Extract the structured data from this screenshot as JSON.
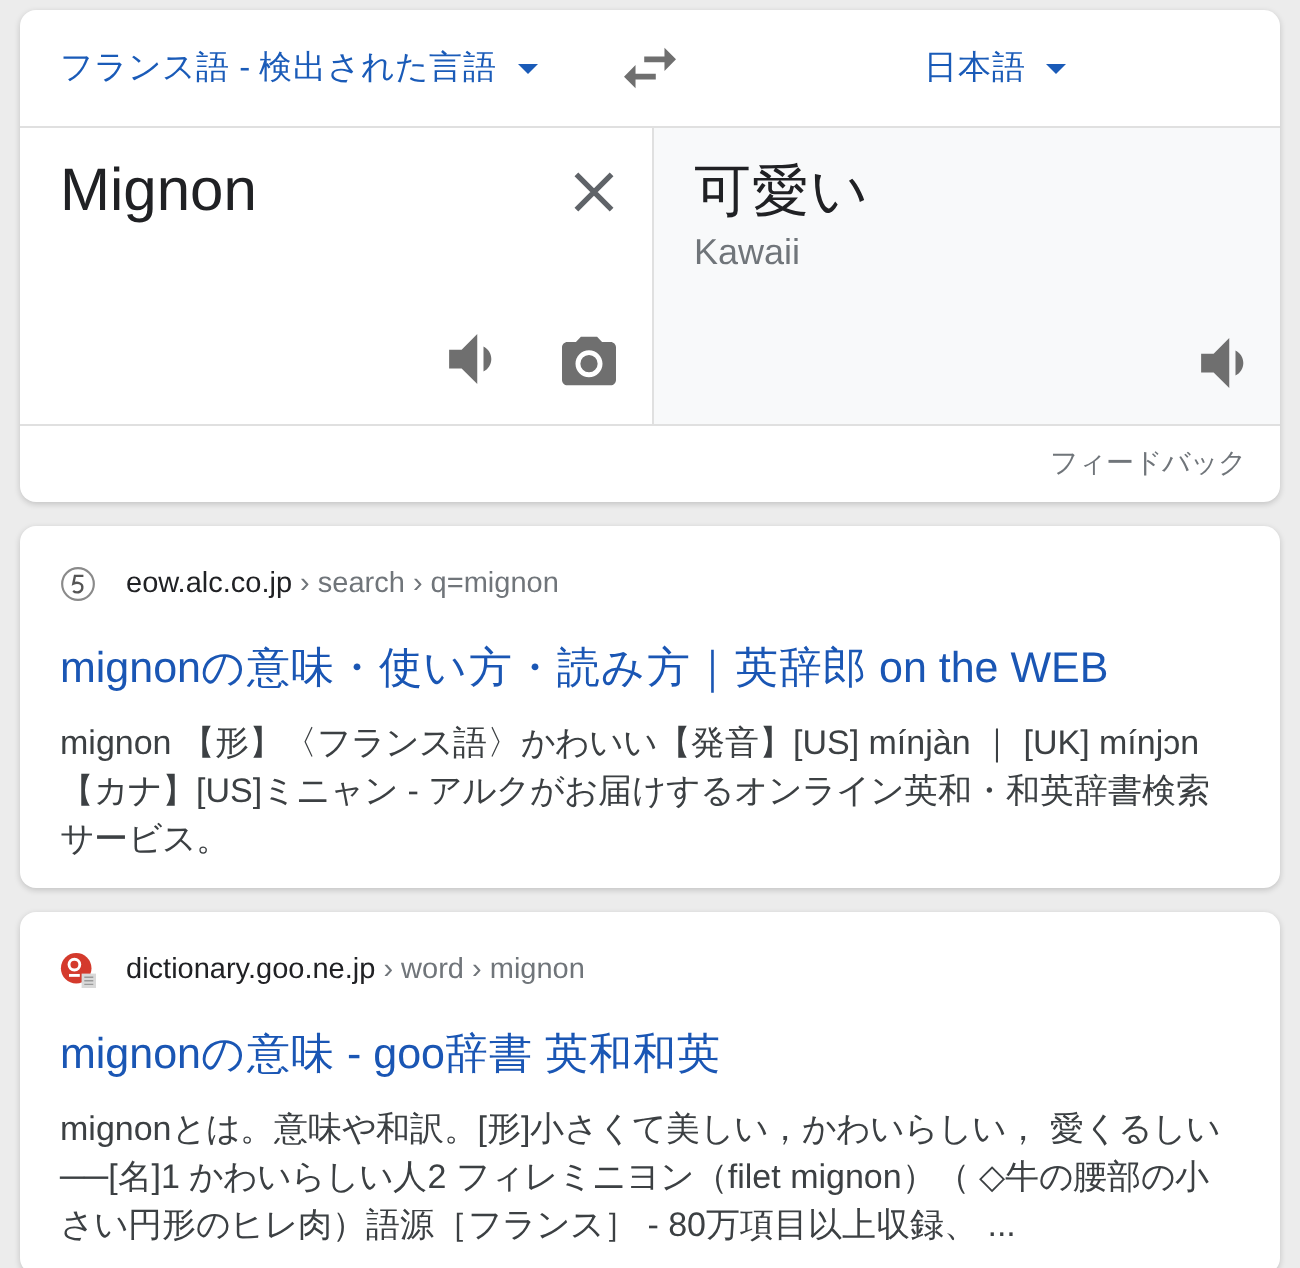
{
  "translator": {
    "source_language": "フランス語 - 検出された言語",
    "target_language": "日本語",
    "source_text": "Mignon",
    "translation": "可愛い",
    "transliteration": "Kawaii",
    "feedback": "フィードバック"
  },
  "results": [
    {
      "kind": "swirl",
      "site": "eow.alc.co.jp",
      "breadcrumb": "› search › q=mignon",
      "title": "mignonの意味・使い方・読み方｜英辞郎 on the WEB",
      "snippet": "mignon 【形】〈フランス語〉かわいい【発音】[US] mínjàn ｜ [UK] mínjɔn 【カナ】[US]ミニャン - アルクがお届けするオンライン英和・和英辞書検索サービス。"
    },
    {
      "kind": "seal",
      "site": "dictionary.goo.ne.jp",
      "breadcrumb": "› word › mignon",
      "title": "mignonの意味 - goo辞書 英和和英",
      "snippet": "mignonとは。意味や和訳。[形]小さくて美しい，かわいらしい， 愛くるしい──[名]1 かわいらしい人2 フィレミニヨン（filet mignon）（ ◇牛の腰部の小さい円形のヒレ肉）語源［フランス］ - 80万項目以上収録、 ..."
    }
  ]
}
